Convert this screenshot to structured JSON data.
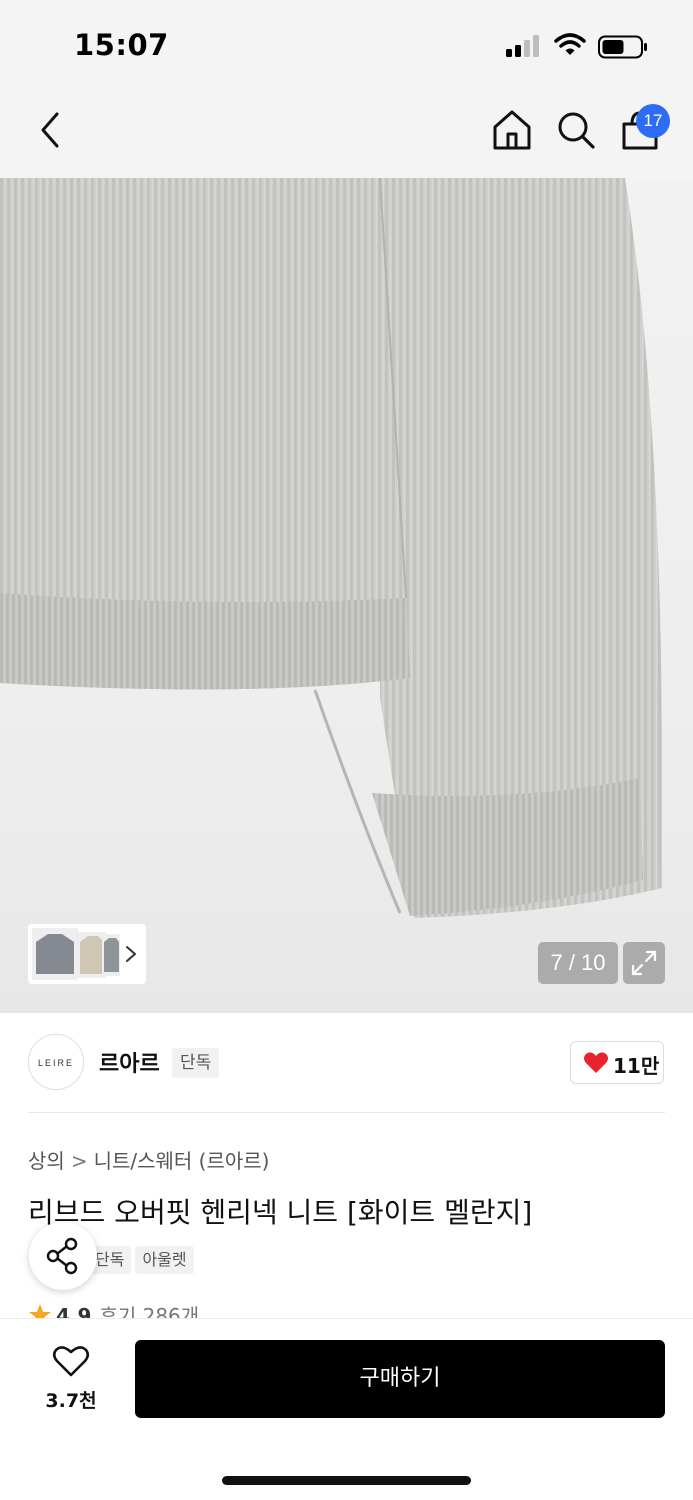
{
  "status_bar": {
    "time": "15:07",
    "signal_icon": "cellular-signal-icon",
    "wifi_icon": "wifi-icon",
    "battery_icon": "battery-icon"
  },
  "nav": {
    "back_icon": "chevron-left-icon",
    "home_icon": "home-icon",
    "search_icon": "search-icon",
    "cart_icon": "shopping-bag-icon",
    "cart_count": "17",
    "accent_color": "#2f6cf6"
  },
  "gallery": {
    "counter": "7 / 10",
    "current_index": 7,
    "total": 10,
    "expand_icon": "expand-icon",
    "thumb_chevron_icon": "chevron-right-icon"
  },
  "brand": {
    "logo_text": "LEIRE",
    "name": "르아르",
    "tag": "단독",
    "like_icon": "heart-icon",
    "like_count": "11만",
    "like_color": "#e8232f"
  },
  "product": {
    "breadcrumb": [
      "상의",
      "니트/스웨터 (르아르)"
    ],
    "title": "리브드 오버핏 헨리넥 니트 [화이트 멜란지]",
    "tags": [
      "단독",
      "아울렛"
    ],
    "share_icon": "share-icon",
    "rating": {
      "star_icon": "star-icon",
      "score": "4.9",
      "reviews_label": "후기 286개"
    }
  },
  "bottom_bar": {
    "wish_icon": "heart-outline-icon",
    "wish_count": "3.7천",
    "buy_label": "구매하기"
  }
}
